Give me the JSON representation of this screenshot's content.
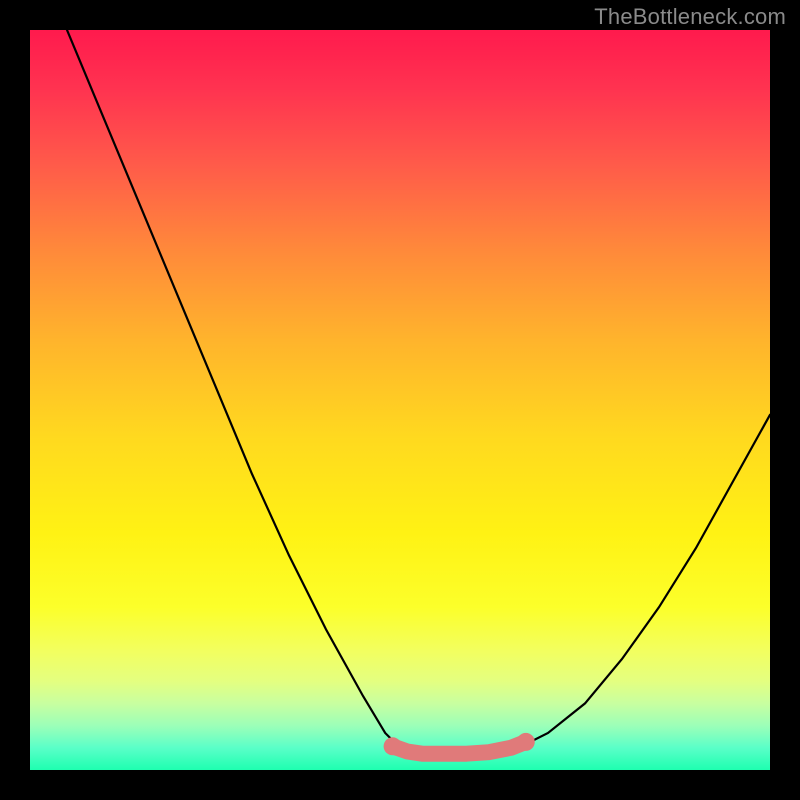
{
  "watermark": "TheBottleneck.com",
  "chart_data": {
    "type": "line",
    "title": "",
    "xlabel": "",
    "ylabel": "",
    "xlim": [
      0,
      100
    ],
    "ylim": [
      0,
      100
    ],
    "series": [
      {
        "name": "bottleneck-curve",
        "x": [
          5,
          10,
          15,
          20,
          25,
          30,
          35,
          40,
          45,
          48,
          50,
          52,
          55,
          58,
          62,
          66,
          70,
          75,
          80,
          85,
          90,
          95,
          100
        ],
        "y": [
          100,
          88,
          76,
          64,
          52,
          40,
          29,
          19,
          10,
          5,
          3,
          2,
          2,
          2,
          2,
          3,
          5,
          9,
          15,
          22,
          30,
          39,
          48
        ]
      }
    ],
    "marker_region": {
      "name": "optimal-band",
      "color": "#e07a7a",
      "x": [
        49,
        51,
        53,
        56,
        59,
        62,
        65,
        67
      ],
      "y": [
        3.2,
        2.5,
        2.2,
        2.2,
        2.2,
        2.4,
        3.0,
        3.8
      ]
    },
    "background_gradient": {
      "top": "#ff1a4d",
      "mid": "#ffe014",
      "bottom": "#1effb0"
    }
  }
}
